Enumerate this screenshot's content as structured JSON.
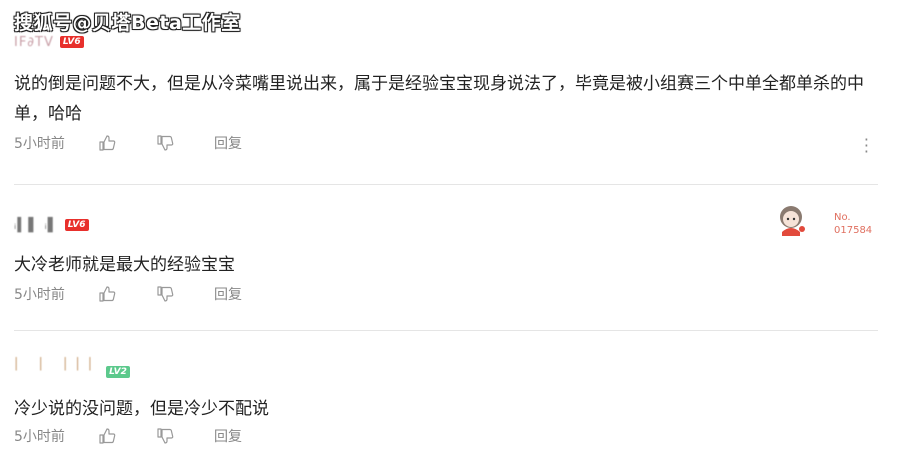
{
  "watermark": "搜狐号@贝塔Beta工作室",
  "comments": [
    {
      "username": "IF∂TV",
      "level": "LV6",
      "text": "说的倒是问题不大，但是从冷菜嘴里说出来，属于是经验宝宝现身说法了，毕竟是被小组赛三个中单全都单杀的中单，哈哈",
      "time": "5小时前",
      "reply_label": "回复"
    },
    {
      "username": "ᵢ▍▌ ᵢ▌",
      "level": "LV6",
      "text": "大冷老师就是最大的经验宝宝",
      "time": "5小时前",
      "reply_label": "回复",
      "badge_label": "No.",
      "badge_number": "017584"
    },
    {
      "username": "| |  |||",
      "level": "LV2",
      "text": "冷少说的没问题，但是冷少不配说",
      "time": "5小时前",
      "reply_label": "回复"
    }
  ],
  "colors": {
    "level_red": "#e8302c",
    "level_green": "#5cc98c",
    "meta_gray": "#888888",
    "divider": "#e5e5e5"
  },
  "icons": [
    "thumbs-up-icon",
    "thumbs-down-icon",
    "more-icon"
  ]
}
